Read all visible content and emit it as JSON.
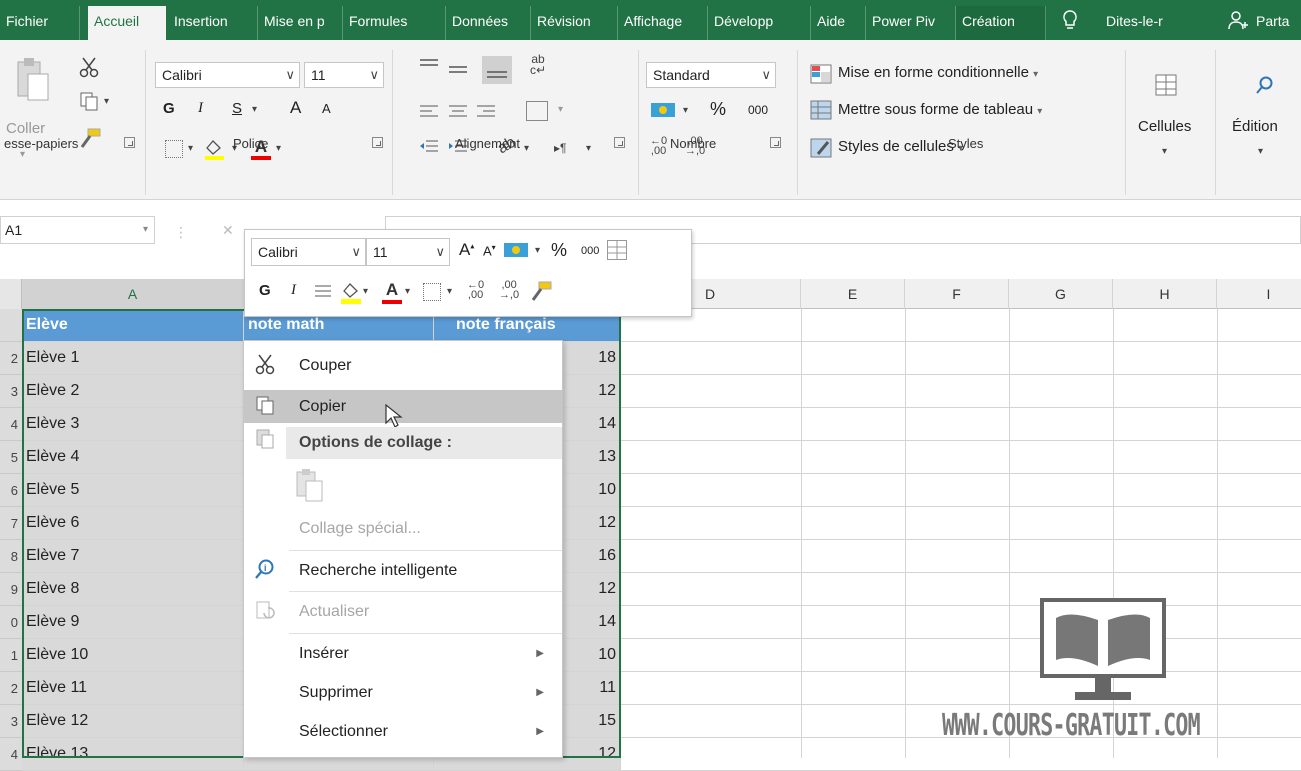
{
  "tabs": [
    "Fichier",
    "Accueil",
    "Insertion",
    "Mise en p",
    "Formules",
    "Données",
    "Révision",
    "Affichage",
    "Développ",
    "Aide",
    "Power Piv",
    "Création",
    "Dites-le-r",
    "Parta"
  ],
  "ribbon": {
    "clipboard": {
      "paste_label": "Coller",
      "group_label": "esse-papiers"
    },
    "font": {
      "name": "Calibri",
      "size": "11",
      "bold": "G",
      "italic": "I",
      "underline": "S",
      "group_label": "Police",
      "grow": "A",
      "shrink": "A"
    },
    "alignment": {
      "group_label": "Alignement"
    },
    "number": {
      "format": "Standard",
      "percent": "%",
      "thousands": "000",
      "group_label": "Nombre"
    },
    "styles": {
      "conditional": "Mise en forme conditionnelle",
      "as_table": "Mettre sous forme de tableau",
      "cell_styles": "Styles de cellules",
      "group_label": "Styles"
    },
    "cells_label": "Cellules",
    "editing_label": "Édition"
  },
  "formula_bar": {
    "name_box": "A1"
  },
  "columns": [
    "A",
    "D",
    "E",
    "F",
    "G",
    "H",
    "I"
  ],
  "rows": [
    {
      "num": "",
      "name": "Elève",
      "math": "note math",
      "fr": "note français",
      "header": true
    },
    {
      "num": "2",
      "name": "Elève 1",
      "fr": "18"
    },
    {
      "num": "3",
      "name": "Elève 2",
      "fr": "12"
    },
    {
      "num": "4",
      "name": "Elève 3",
      "fr": "14"
    },
    {
      "num": "5",
      "name": "Elève 4",
      "fr": "13"
    },
    {
      "num": "6",
      "name": "Elève 5",
      "fr": "10"
    },
    {
      "num": "7",
      "name": "Elève 6",
      "fr": "12"
    },
    {
      "num": "8",
      "name": "Elève 7",
      "fr": "16"
    },
    {
      "num": "9",
      "name": "Elève 8",
      "fr": "12"
    },
    {
      "num": "0",
      "name": "Elève 9",
      "fr": "14"
    },
    {
      "num": "1",
      "name": "Elève 10",
      "fr": "10"
    },
    {
      "num": "2",
      "name": "Elève 11",
      "fr": "11"
    },
    {
      "num": "3",
      "name": "Elève 12",
      "fr": "15"
    },
    {
      "num": "4",
      "name": "Elève 13",
      "fr": "12"
    }
  ],
  "mini_toolbar": {
    "font": "Calibri",
    "size": "11",
    "bold": "G",
    "italic": "I",
    "percent": "%",
    "thousands": "000"
  },
  "context_menu": {
    "cut": "Couper",
    "copy": "Copier",
    "paste_options": "Options de collage :",
    "paste_special": "Collage spécial...",
    "smart_lookup": "Recherche intelligente",
    "refresh": "Actualiser",
    "insert": "Insérer",
    "delete": "Supprimer",
    "select": "Sélectionner"
  },
  "watermark": "WWW.COURS-GRATUIT.COM",
  "colors": {
    "excel_green": "#217346",
    "header_blue": "#5b9bd5",
    "selection_gray": "#d9d9d9"
  }
}
